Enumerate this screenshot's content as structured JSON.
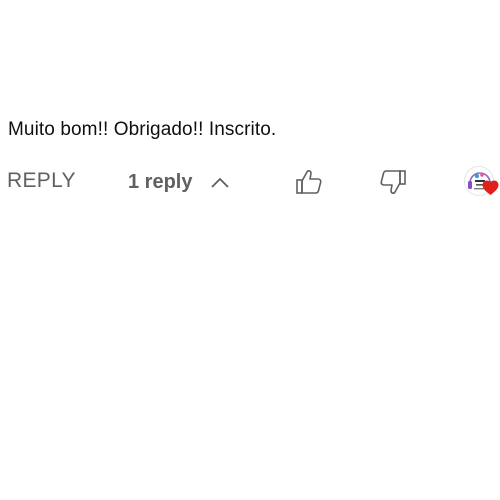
{
  "comment": {
    "text": "Muito bom!! Obrigado!! Inscrito."
  },
  "actions": {
    "reply_label": "REPLY",
    "replies_toggle_label": "1 reply",
    "replies_toggle_icon": "chevron-up-icon",
    "like_icon": "thumbs-up-icon",
    "dislike_icon": "thumbs-down-icon",
    "creator_heart_icon": "heart-icon"
  },
  "colors": {
    "text": "#0f0f0f",
    "secondary": "#606060",
    "heart": "#e0201a"
  }
}
